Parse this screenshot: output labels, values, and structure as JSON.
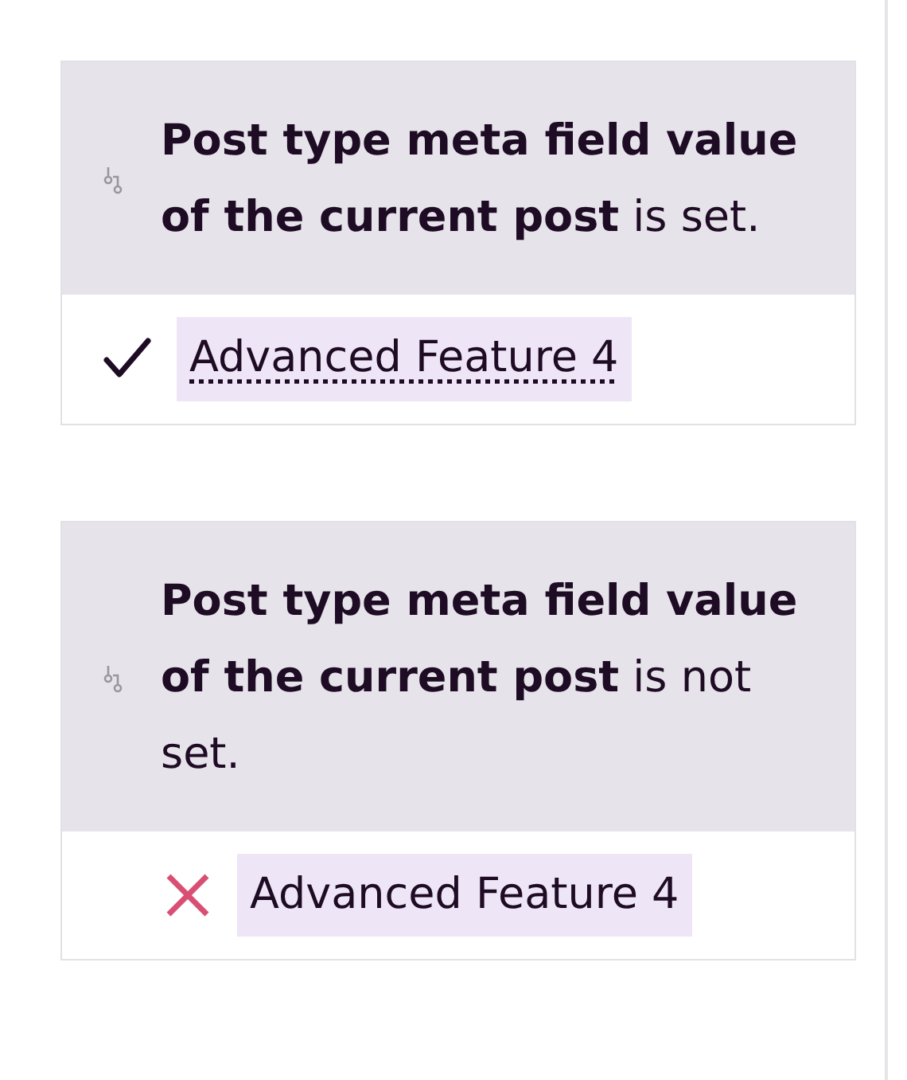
{
  "conditions": [
    {
      "text": "**Post type meta field value of the current post** is set.",
      "result": {
        "kind": "check",
        "label": "Advanced Feature 4",
        "linked": true
      }
    },
    {
      "text": "**Post type meta field value of the current post** is not set.",
      "result": {
        "kind": "cross",
        "label": "Advanced Feature 4",
        "linked": false
      }
    }
  ]
}
